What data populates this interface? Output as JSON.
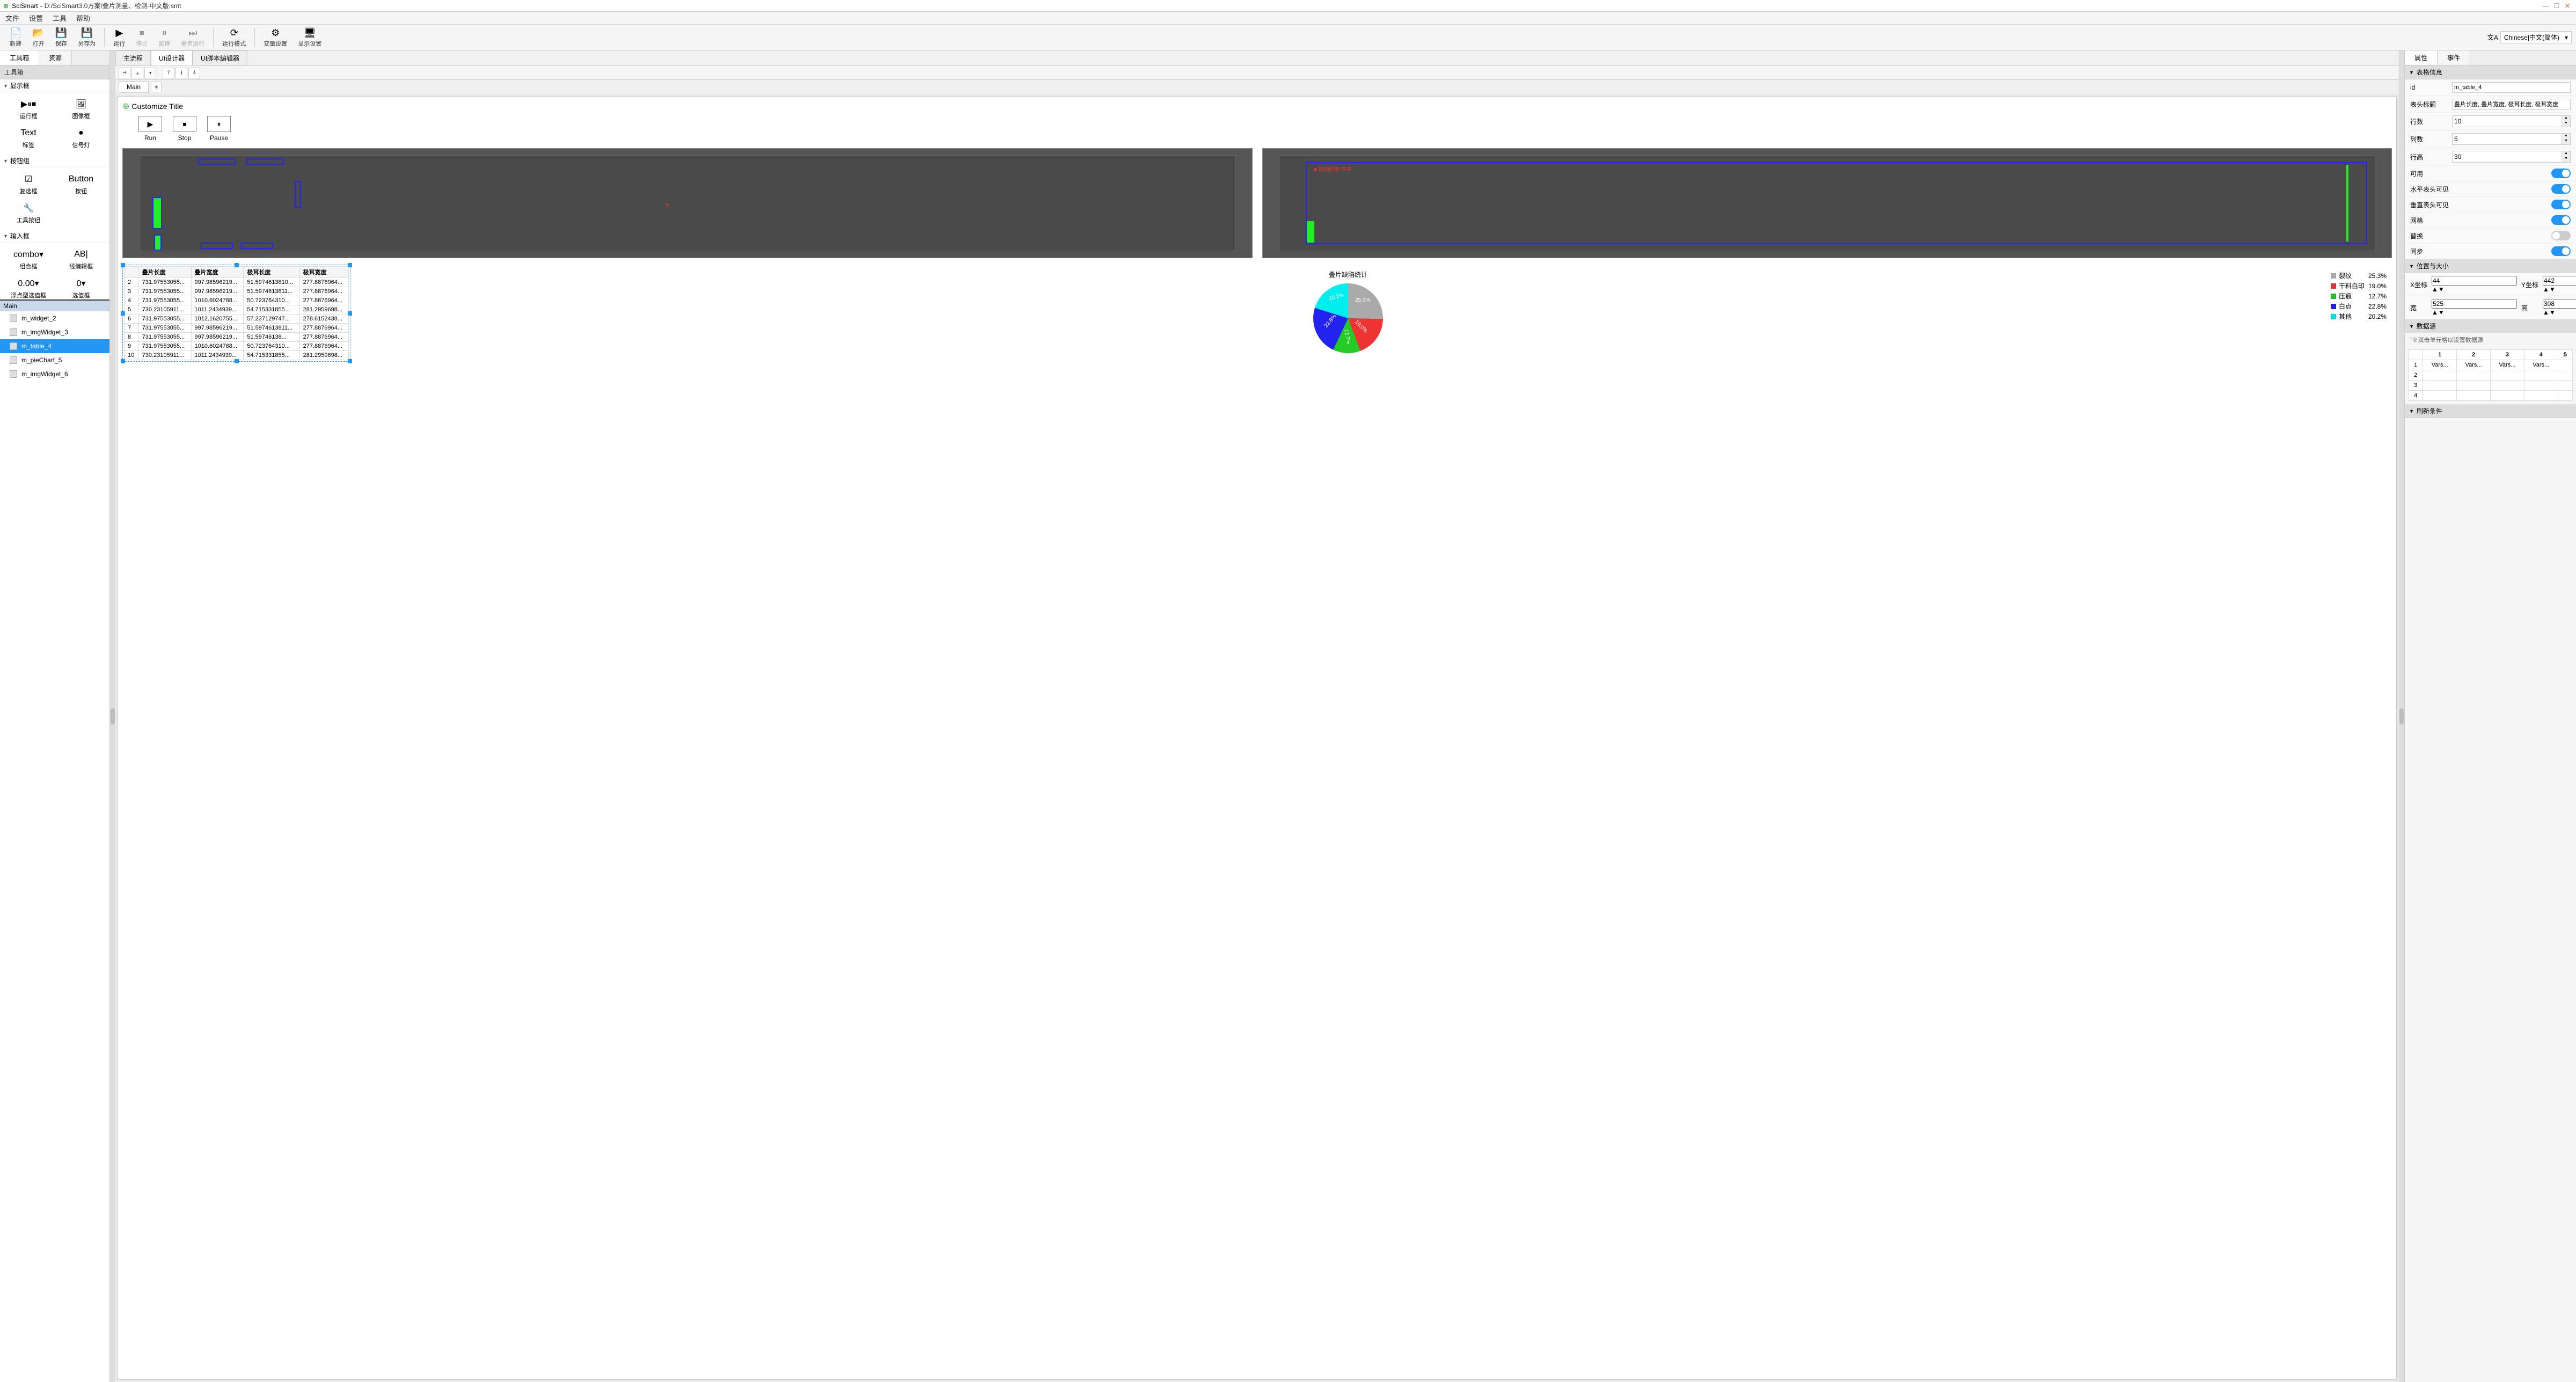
{
  "app": {
    "name": "SciSmart",
    "title": "D:/SciSmart3.0方案/叠片测量、检测-中文版.smt"
  },
  "menu": [
    "文件",
    "设置",
    "工具",
    "帮助"
  ],
  "toolbar": {
    "items": [
      {
        "icon": "📄",
        "label": "新建"
      },
      {
        "icon": "📂",
        "label": "打开"
      },
      {
        "icon": "💾",
        "label": "保存"
      },
      {
        "icon": "💾",
        "label": "另存为"
      }
    ],
    "run": [
      {
        "icon": "▶",
        "label": "运行"
      },
      {
        "icon": "⏹",
        "label": "停止",
        "dis": true
      },
      {
        "icon": "⏸",
        "label": "暂停",
        "dis": true
      },
      {
        "icon": "⏭",
        "label": "单步运行",
        "dis": true
      }
    ],
    "mode": [
      {
        "icon": "⟳",
        "label": "运行模式"
      }
    ],
    "cfg": [
      {
        "icon": "⚙",
        "label": "变量设置"
      },
      {
        "icon": "🖥",
        "label": "显示设置"
      }
    ],
    "lang": "Chinese|中文(简体)"
  },
  "left": {
    "tabs": [
      "工具箱",
      "资源"
    ],
    "header": "工具箱",
    "groups": [
      {
        "title": "显示框",
        "items": [
          [
            "▶⏸⏹",
            "运行框"
          ],
          [
            "🖼",
            "图像框"
          ],
          [
            "Text",
            "标签"
          ],
          [
            "●",
            "信号灯"
          ]
        ]
      },
      {
        "title": "按钮组",
        "items": [
          [
            "☑",
            "复选框"
          ],
          [
            "Button",
            "按钮"
          ],
          [
            "🔧",
            "工具按钮"
          ],
          [
            "",
            ""
          ]
        ]
      },
      {
        "title": "输入框",
        "items": [
          [
            "combo▾",
            "组合框"
          ],
          [
            "AB|",
            "线编辑框"
          ],
          [
            "0.00▾",
            "浮点型选值框"
          ],
          [
            "0▾",
            "选值框"
          ]
        ]
      }
    ],
    "outline": {
      "header": "Main",
      "items": [
        "m_widget_2",
        "m_imgWidget_3",
        "m_table_4",
        "m_pieChart_5",
        "m_imgWidget_6"
      ],
      "selected": 2
    }
  },
  "center": {
    "tabs": [
      "主流程",
      "UI设计器",
      "UI脚本编辑器"
    ],
    "design_tab": "Main",
    "custom_title": "Customize Title",
    "run_btns": [
      [
        "▶",
        "Run"
      ],
      [
        "⏹",
        "Stop"
      ],
      [
        "⏸",
        "Pause"
      ]
    ],
    "table": {
      "headers": [
        "",
        "叠片长度",
        "叠片宽度",
        "极耳长度",
        "极耳宽度"
      ],
      "rows": [
        [
          "2",
          "731.97553055...",
          "997.98596219...",
          "51.5974613810...",
          "277.8876964..."
        ],
        [
          "3",
          "731.97553055...",
          "997.98596219...",
          "51.5974613811...",
          "277.8876964..."
        ],
        [
          "4",
          "731.97553055...",
          "1010.6024788...",
          "50.723764310...",
          "277.8876964..."
        ],
        [
          "5",
          "730.23105911...",
          "1011.2434939...",
          "54.715331855...",
          "281.2959698..."
        ],
        [
          "6",
          "731.97553055...",
          "1012.1620755...",
          "57.237129747...",
          "278.6152438..."
        ],
        [
          "7",
          "731.97553055...",
          "997.98596219...",
          "51.5974613811...",
          "277.8876964..."
        ],
        [
          "8",
          "731.97553055...",
          "997.98596219...",
          "51.59746138...",
          "277.8876964..."
        ],
        [
          "9",
          "731.97553055...",
          "1010.6024788...",
          "50.723764310...",
          "277.8876964..."
        ],
        [
          "10",
          "730.23105911...",
          "1011.2434939...",
          "54.715331855...",
          "281.2959698..."
        ]
      ]
    }
  },
  "chart_data": {
    "type": "pie",
    "title": "叠片缺陷统计",
    "series": [
      {
        "name": "裂纹",
        "value": 25.3,
        "color": "#aaaaaa"
      },
      {
        "name": "干料白印",
        "value": 19.0,
        "color": "#e03030"
      },
      {
        "name": "压痕",
        "value": 12.7,
        "color": "#20c020"
      },
      {
        "name": "白点",
        "value": 22.8,
        "color": "#2020e0"
      },
      {
        "name": "其他",
        "value": 20.2,
        "color": "#00e0e0"
      }
    ]
  },
  "right": {
    "tabs": [
      "属性",
      "事件"
    ],
    "sections": {
      "table_info": {
        "title": "表格信息",
        "id_label": "id",
        "id": "m_table_4",
        "header_label": "表头标题",
        "header": "叠片长度, 叠片宽度, 极耳长度, 极耳宽度",
        "rows_label": "行数",
        "rows": "10",
        "cols_label": "列数",
        "cols": "5",
        "rowh_label": "行高",
        "rowh": "30",
        "enable_label": "可用",
        "hh_label": "水平表头可见",
        "vh_label": "垂直表头可见",
        "grid_label": "网格",
        "alt_label": "替换",
        "sync_label": "同步"
      },
      "pos": {
        "title": "位置与大小",
        "x_label": "X坐标",
        "x": "44",
        "y_label": "Y坐标",
        "y": "442",
        "w_label": "宽",
        "w": "525",
        "h_label": "高",
        "h": "308"
      },
      "ds": {
        "title": "数据源",
        "note": "`※双击单元格以设置数据源",
        "cols": [
          "1",
          "2",
          "3",
          "4",
          "5"
        ],
        "row1": [
          "1",
          "Vars...",
          "Vars...",
          "Vars...",
          "Vars...",
          ""
        ]
      },
      "refresh": "刷新条件"
    }
  }
}
